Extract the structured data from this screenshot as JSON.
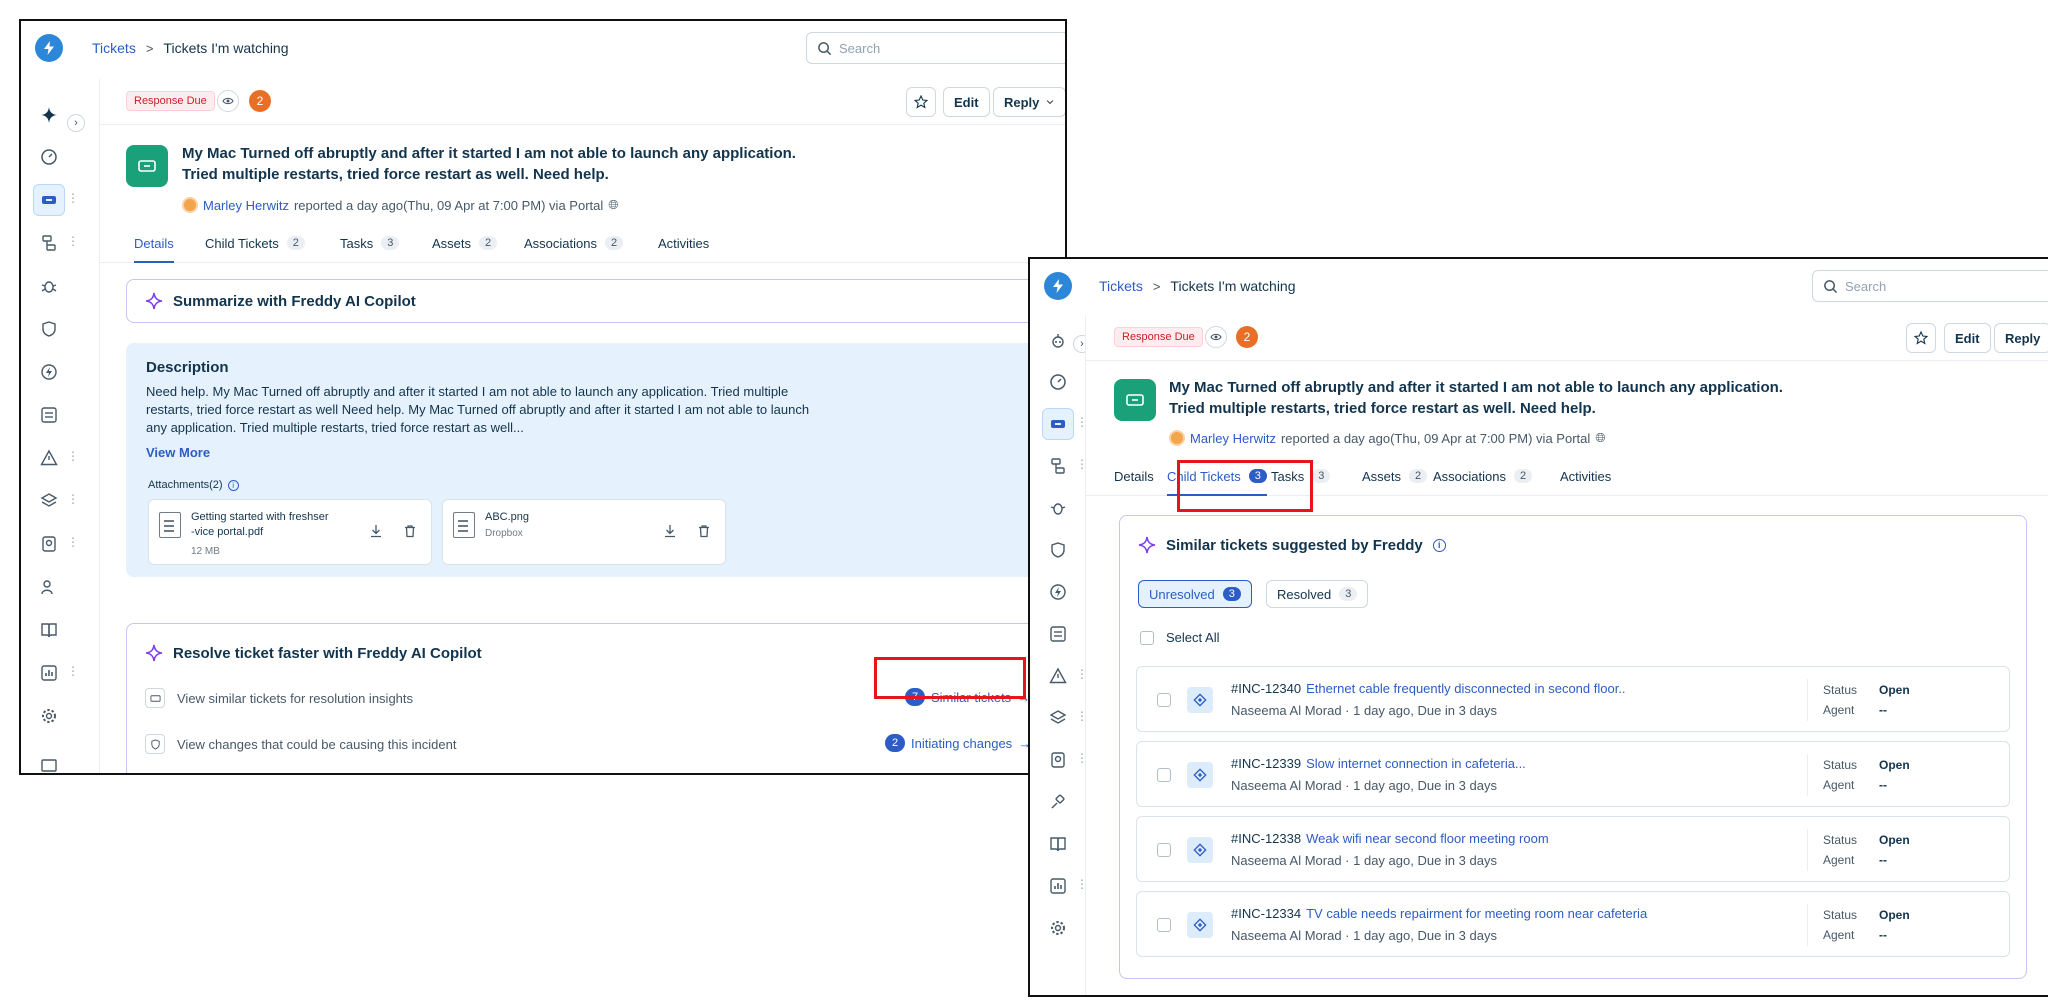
{
  "header": {
    "breadcrumb_root": "Tickets",
    "breadcrumb_sep": ">",
    "breadcrumb_current": "Tickets I'm watching",
    "search_placeholder": "Search"
  },
  "ticket": {
    "status_badge": "Response Due",
    "watcher_count": "2",
    "edit_label": "Edit",
    "reply_label": "Reply",
    "title_line1": "My Mac Turned off abruptly and after it started I am not able to launch any application.",
    "title_line2": "Tried multiple restarts, tried force restart as well. Need help.",
    "requester": "Marley Herwitz",
    "reported_text": "reported a day ago(Thu, 09 Apr at 7:00 PM) via Portal"
  },
  "tabs": {
    "details": "Details",
    "child_tickets": "Child Tickets",
    "tasks": "Tasks",
    "tasks_count": "3",
    "assets": "Assets",
    "assets_count": "2",
    "associations": "Associations",
    "associations_count": "2",
    "activities": "Activities",
    "child_count_shot1": "2",
    "child_count_shot2": "3"
  },
  "copilot": {
    "summarize_label": "Summarize with Freddy AI Copilot"
  },
  "description": {
    "heading": "Description",
    "text_line1": "Need help. My Mac Turned off abruptly and after it started I am not able to launch any application. Tried multiple",
    "text_line2": "restarts, tried force restart as well Need help. My Mac Turned off abruptly and after it started I am not able to launch",
    "text_line3": "any application. Tried multiple restarts, tried force restart as well...",
    "view_more": "View More",
    "attachments_label": "Attachments(2)",
    "attachments": [
      {
        "name_line1": "Getting started with freshser",
        "name_line2": "-vice portal.pdf",
        "sub": "12 MB"
      },
      {
        "name_line1": "ABC.png",
        "name_line2": "",
        "sub": "Dropbox"
      }
    ]
  },
  "resolve": {
    "title": "Resolve ticket faster with Freddy AI Copilot",
    "row1_text": "View similar tickets for resolution insights",
    "row1_count": "7",
    "row1_link": "Similar tickets",
    "row2_text": "View changes that could be causing this incident",
    "row2_count": "2",
    "row2_link": "Initiating changes"
  },
  "similar": {
    "title": "Similar tickets suggested by Freddy",
    "info_glyph": "i",
    "filter_unresolved": "Unresolved",
    "filter_unresolved_count": "3",
    "filter_resolved": "Resolved",
    "filter_resolved_count": "3",
    "select_all": "Select All",
    "status_label": "Status",
    "agent_label": "Agent",
    "rows": [
      {
        "id": "#INC-12340",
        "subject": "Ethernet cable frequently disconnected in second floor..",
        "requester": "Naseema Al Morad",
        "when": "1 day ago, Due in 3 days",
        "status": "Open",
        "agent": "--"
      },
      {
        "id": "#INC-12339",
        "subject": "Slow internet connection in cafeteria...",
        "requester": "Naseema Al Morad",
        "when": "1 day ago, Due in 3 days",
        "status": "Open",
        "agent": "--"
      },
      {
        "id": "#INC-12338",
        "subject": "Weak wifi near second floor meeting room",
        "requester": "Naseema Al Morad",
        "when": "1 day ago, Due in 3 days",
        "status": "Open",
        "agent": "--"
      },
      {
        "id": "#INC-12334",
        "subject": "TV cable needs repairment for meeting room near cafeteria",
        "requester": "Naseema Al Morad",
        "when": "1 day ago, Due in 3 days",
        "status": "Open",
        "agent": "--"
      }
    ]
  },
  "colors": {
    "link": "#2c5cc5",
    "highlight": "#e8141b",
    "ticket_green": "#1ba17a",
    "badge_orange": "#e86f25"
  }
}
